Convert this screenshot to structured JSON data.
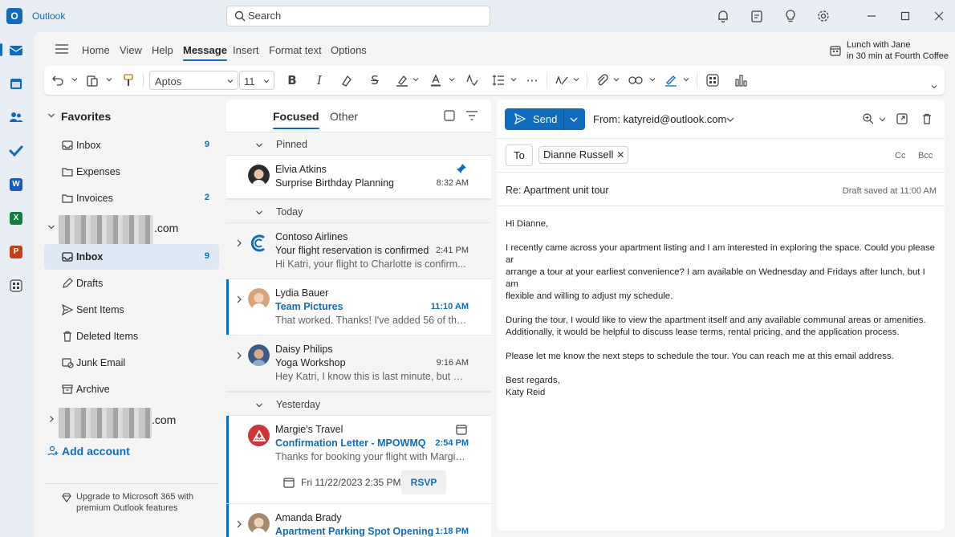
{
  "app": {
    "name": "Outlook",
    "logo_letter": "O"
  },
  "search": {
    "placeholder": "Search"
  },
  "titlebar_icons": [
    "bell-icon",
    "clipboard-icon",
    "lightbulb-icon",
    "gear-icon",
    "minimize-icon",
    "maximize-icon",
    "close-icon"
  ],
  "rail": [
    {
      "name": "mail",
      "active": true
    },
    {
      "name": "calendar"
    },
    {
      "name": "people"
    },
    {
      "name": "todo"
    },
    {
      "name": "word",
      "letter": "W",
      "color": "#185abd"
    },
    {
      "name": "excel",
      "letter": "X",
      "color": "#107c41"
    },
    {
      "name": "powerpoint",
      "letter": "P",
      "color": "#c43e1c"
    },
    {
      "name": "apps"
    }
  ],
  "ribbon": {
    "tabs": [
      "Home",
      "View",
      "Help",
      "Message",
      "Insert",
      "Format text",
      "Options"
    ],
    "active_tab": "Message",
    "font_name": "Aptos",
    "font_size": "11"
  },
  "reminder": {
    "title": "Lunch with Jane",
    "detail": "in 30 min at Fourth Coffee"
  },
  "folders": {
    "favorites_label": "Favorites",
    "favorites": [
      {
        "label": "Inbox",
        "count": "9"
      },
      {
        "label": "Expenses",
        "count": ""
      },
      {
        "label": "Invoices",
        "count": "2"
      }
    ],
    "account1_suffix": ".com",
    "account1": [
      {
        "label": "Inbox",
        "count": "9",
        "selected": true
      },
      {
        "label": "Drafts",
        "count": ""
      },
      {
        "label": "Sent Items",
        "count": ""
      },
      {
        "label": "Deleted Items",
        "count": ""
      },
      {
        "label": "Junk Email",
        "count": ""
      },
      {
        "label": "Archive",
        "count": ""
      }
    ],
    "account2_suffix": ".com",
    "add_account": "Add account",
    "upgrade": "Upgrade to Microsoft 365 with premium Outlook features"
  },
  "list": {
    "tab_focused": "Focused",
    "tab_other": "Other",
    "sections": {
      "pinned": "Pinned",
      "today": "Today",
      "yesterday": "Yesterday"
    },
    "messages": [
      {
        "sender": "Elvia Atkins",
        "subject": "Surprise Birthday Planning",
        "time": "8:32 AM",
        "preview": ""
      },
      {
        "sender": "Contoso Airlines",
        "subject": "Your flight reservation is confirmed",
        "time": "2:41 PM",
        "preview": "Hi Katri, your flight to Charlotte is confirm..."
      },
      {
        "sender": "Lydia Bauer",
        "subject": "Team Pictures",
        "time": "11:10 AM",
        "preview": "That worked. Thanks! I've added 56 of the..."
      },
      {
        "sender": "Daisy Philips",
        "subject": "Yoga Workshop",
        "time": "9:16 AM",
        "preview": "Hey Katri, I know this is last minute, but do..."
      },
      {
        "sender": "Margie's Travel",
        "subject": "Confirmation Letter - MPOWMQ",
        "time": "2:54 PM",
        "preview": "Thanks for booking your flight with Margie...",
        "event": "Fri 11/22/2023 2:35 PM -...",
        "rsvp": "RSVP"
      },
      {
        "sender": "Amanda Brady",
        "subject": "Apartment Parking Spot Opening",
        "time": "1:18 PM",
        "preview": ""
      }
    ]
  },
  "compose": {
    "send_label": "Send",
    "from": "From: katyreid@outlook.com",
    "to_label": "To",
    "recipient": "Dianne Russell",
    "cc": "Cc",
    "bcc": "Bcc",
    "subject": "Re: Apartment unit tour",
    "draft_status": "Draft saved at 11:00 AM",
    "greeting": "Hi Dianne,",
    "para1": "I recently came across your apartment listing and I am interested in exploring the space. Could you please ar\narrange a tour at your earliest convenience? I am available on Wednesday and Fridays after lunch, but I am\nflexible and willing to adjust my schedule.",
    "para2": "During the tour, I would like to view the apartment itself and any available communal areas or amenities.\nAdditionally, it would be helpful to discuss lease terms, rental pricing, and the application process.",
    "para3": "Please let me know the next steps to schedule the tour. You can reach me at this email address.",
    "signoff": "Best regards,\nKaty Reid"
  },
  "colors": {
    "accent": "#0f6cbd",
    "selected_folder": "#dfe8f5"
  }
}
